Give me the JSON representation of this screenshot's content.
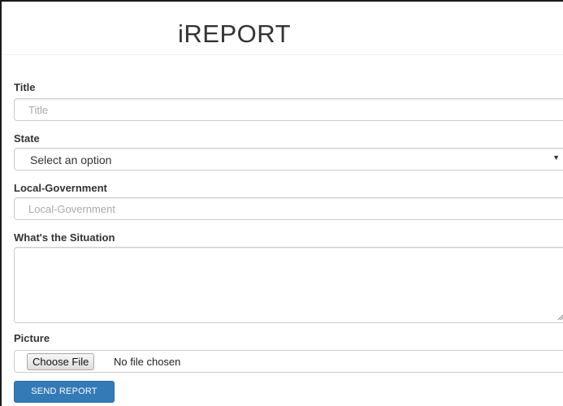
{
  "header": {
    "title": "iREPORT"
  },
  "form": {
    "title": {
      "label": "Title",
      "placeholder": "Title"
    },
    "state": {
      "label": "State",
      "selected": "Select an option"
    },
    "local_government": {
      "label": "Local-Government",
      "placeholder": "Local-Government"
    },
    "situation": {
      "label": "What's the Situation",
      "value": ""
    },
    "picture": {
      "label": "Picture",
      "button_label": "Choose File",
      "status": "No file chosen"
    },
    "submit_label": "SEND REPORT"
  },
  "colors": {
    "primary_button": "#337ab7",
    "field_border": "#cccccc"
  }
}
